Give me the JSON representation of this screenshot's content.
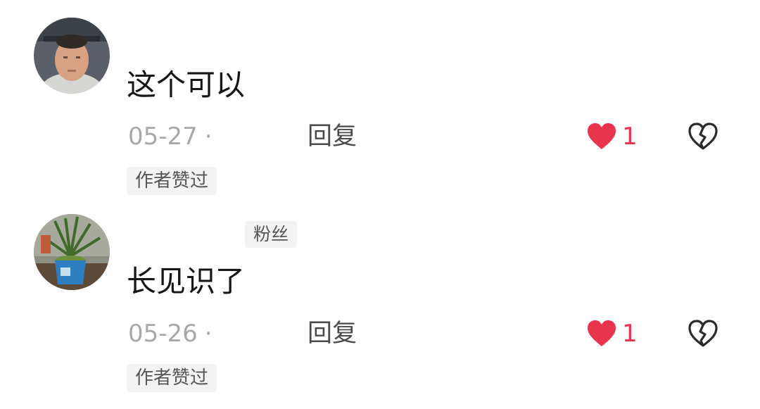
{
  "comments": [
    {
      "text": "这个可以",
      "date": "05-27",
      "separator": "·",
      "reply_label": "回复",
      "like_count": "1",
      "author_liked_label": "作者赞过"
    },
    {
      "fan_badge": "粉丝",
      "text": "长见识了",
      "date": "05-26",
      "separator": "·",
      "reply_label": "回复",
      "like_count": "1",
      "author_liked_label": "作者赞过"
    }
  ],
  "icons": {
    "like": "heart-icon",
    "dislike": "broken-heart-icon"
  },
  "colors": {
    "like_active": "#e9344e",
    "meta_text": "#a8a8a8",
    "tag_background": "#f3f3f3"
  }
}
